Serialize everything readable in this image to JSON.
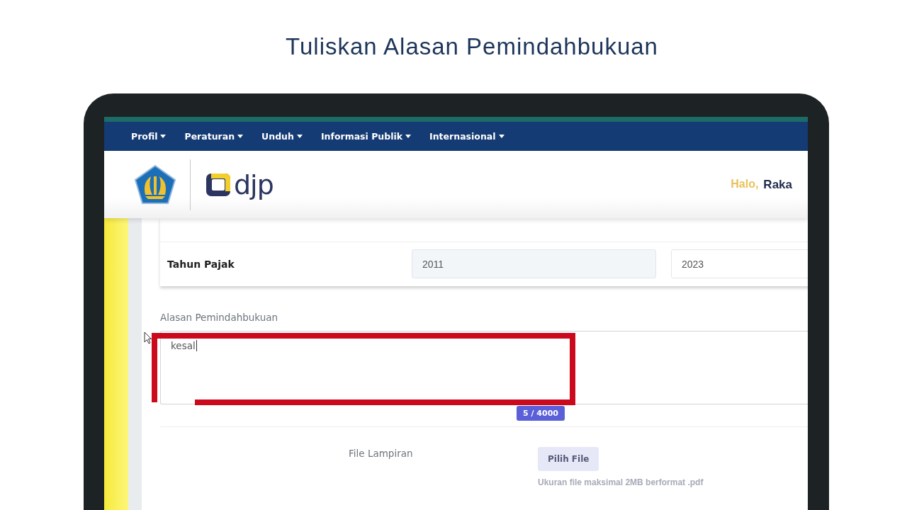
{
  "title": "Tuliskan Alasan Pemindahbukuan",
  "nav": [
    {
      "label": "Profil"
    },
    {
      "label": "Peraturan"
    },
    {
      "label": "Unduh"
    },
    {
      "label": "Informasi Publik"
    },
    {
      "label": "Internasional"
    }
  ],
  "header": {
    "logo_text": "djp",
    "greeting": "Halo,",
    "user": "Raka"
  },
  "form": {
    "rows": [
      {
        "label": "Tahun Pajak",
        "from": "2011",
        "to": "2023"
      }
    ],
    "reason": {
      "label": "Alasan Pemindahbukuan",
      "value": "kesal",
      "counter": "5 / 4000"
    },
    "attachment": {
      "label": "File Lampiran",
      "button": "Pilih File",
      "hint": "Ukuran file maksimal 2MB berformat .pdf"
    }
  }
}
